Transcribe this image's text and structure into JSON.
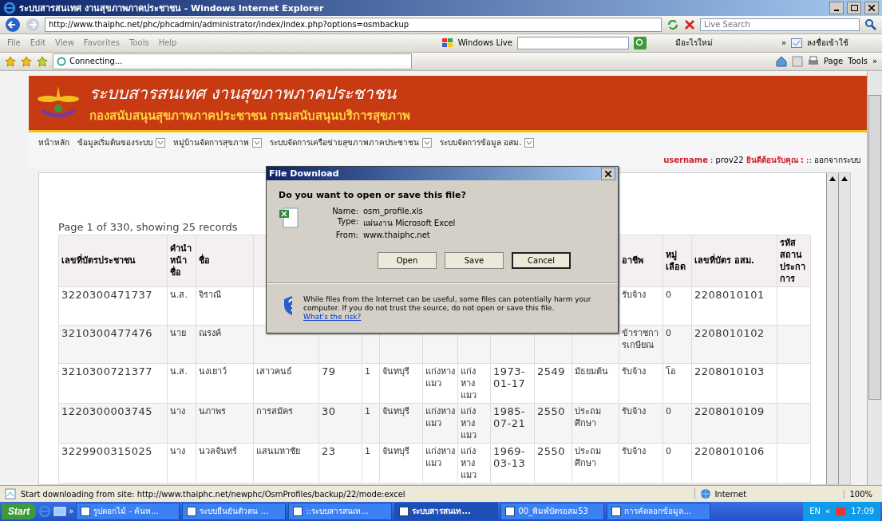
{
  "window": {
    "title": "ระบบสารสนเทศ งานสุขภาพภาคประชาชน - Windows Internet Explorer"
  },
  "address_bar": {
    "url": "http://www.thaiphc.net/phc/phcadmin/administrator/index/index.php?options=osmbackup",
    "search_placeholder": "Live Search"
  },
  "menu_bar": {
    "items": [
      "File",
      "Edit",
      "View",
      "Favorites",
      "Tools",
      "Help"
    ],
    "windows_live": "Windows Live",
    "whats_new": "มีอะไรใหม่",
    "more": "»",
    "sign_in": "ลงชื่อเข้าใช้"
  },
  "favorites_bar": {
    "tab": "Connecting...",
    "tools": [
      "Page",
      "Tools"
    ],
    "more": "»"
  },
  "site": {
    "title": "ระบบสารสนเทศ งานสุขภาพภาคประชาชน",
    "subtitle": "กองสนับสนุนสุขภาพภาคประชาชน กรมสนับสนุนบริการสุขภาพ",
    "nav": [
      {
        "label": "หน้าหลัก",
        "dropdown": false
      },
      {
        "label": "ข้อมูลเริ่มต้นของระบบ",
        "dropdown": true
      },
      {
        "label": "หมู่บ้านจัดการสุขภาพ",
        "dropdown": true
      },
      {
        "label": "ระบบจัดการเครือข่ายสุขภาพภาคประชาชน",
        "dropdown": true
      },
      {
        "label": "ระบบจัดการข้อมูล อสม.",
        "dropdown": true
      }
    ],
    "user": {
      "label": "username",
      "name": ": prov22",
      "welcome": "ยินดีต้อนรับคุณ :",
      "logout": ":: ออกจากระบบ"
    }
  },
  "pager": "Page 1 of 330, showing 25 records",
  "table": {
    "columns": [
      "เลขที่บัตรประชาชน",
      "คำนำหน้าชื่อ",
      "ชื่อ",
      null,
      null,
      null,
      null,
      null,
      null,
      null,
      null,
      null,
      "อาชีพ",
      "หมู่เลือด",
      "เลขที่บัตร อสม.",
      "รหัสสถาน ประกา การ"
    ],
    "rows": [
      {
        "cells": [
          "3220300471737",
          "น.ส.",
          "จิราณี",
          null,
          null,
          null,
          null,
          null,
          null,
          null,
          null,
          null,
          "รับจ้าง",
          "0",
          "2208010101",
          null
        ]
      },
      {
        "cells": [
          "3210300477476",
          "นาย",
          "ณรงค์",
          null,
          null,
          null,
          null,
          null,
          null,
          null,
          null,
          null,
          "ข้าราชการเกษียณ",
          "0",
          "2208010102",
          null
        ]
      },
      {
        "cells": [
          "3210300721377",
          "น.ส.",
          "นงเยาว์",
          "เสาวคนธ์",
          "79",
          "1",
          "จันทบุรี",
          "แก่งหางแมว",
          "แก่งหางแมว",
          "1973-01-17",
          "2549",
          "มัธยมต้น",
          "รับจ้าง",
          "โอ",
          "2208010103",
          null
        ]
      },
      {
        "cells": [
          "1220300003745",
          "นาง",
          "นภาพร",
          "การสมัคร",
          "30",
          "1",
          "จันทบุรี",
          "แก่งหางแมว",
          "แก่งหางแมว",
          "1985-07-21",
          "2550",
          "ประถมศึกษา",
          "รับจ้าง",
          "0",
          "2208010109",
          null
        ]
      },
      {
        "cells": [
          "3229900315025",
          "นาง",
          "นวลจันทร์",
          "แสนมหาชัย",
          "23",
          "1",
          "จันทบุรี",
          "แก่งหางแมว",
          "แก่งหางแมว",
          "1969-03-13",
          "2550",
          "ประถมศึกษา",
          "รับจ้าง",
          "0",
          "2208010106",
          null
        ]
      }
    ]
  },
  "dialog": {
    "title": "File Download",
    "question": "Do you want to open or save this file?",
    "fields": [
      {
        "label": "Name:",
        "value": "osm_profile.xls"
      },
      {
        "label": "Type:",
        "value": "แผ่นงาน Microsoft Excel"
      },
      {
        "label": "From:",
        "value": "www.thaiphc.net"
      }
    ],
    "buttons": [
      {
        "label": "Open",
        "focused": false
      },
      {
        "label": "Save",
        "focused": false
      },
      {
        "label": "Cancel",
        "focused": true
      }
    ],
    "warning": "While files from the Internet can be useful, some files can potentially harm your computer. If you do not trust the source, do not open or save this file.",
    "link": "What's the risk?"
  },
  "status_bar": {
    "text": "Start downloading from site: http://www.thaiphc.net/newphc/OsmProfiles/backup/22/mode:excel",
    "zone": "Internet",
    "zoom": "100%"
  },
  "taskbar": {
    "start": "Start",
    "more": "»",
    "tasks": [
      {
        "label": "รูปดอกไม้ - ค้นห...",
        "selected": false
      },
      {
        "label": "ระบบยืนยันตัวตน ...",
        "selected": false
      },
      {
        "label": "::ระบบสารสนเท...",
        "selected": false
      },
      {
        "label": "ระบบสารสนเท...",
        "selected": true
      },
      {
        "label": "00_พิมพ์บัตรอสม53",
        "selected": false
      },
      {
        "label": "การคัดลอกข้อมูล...",
        "selected": false
      }
    ],
    "language": "EN",
    "collapse": "«",
    "clock": "17:09"
  }
}
